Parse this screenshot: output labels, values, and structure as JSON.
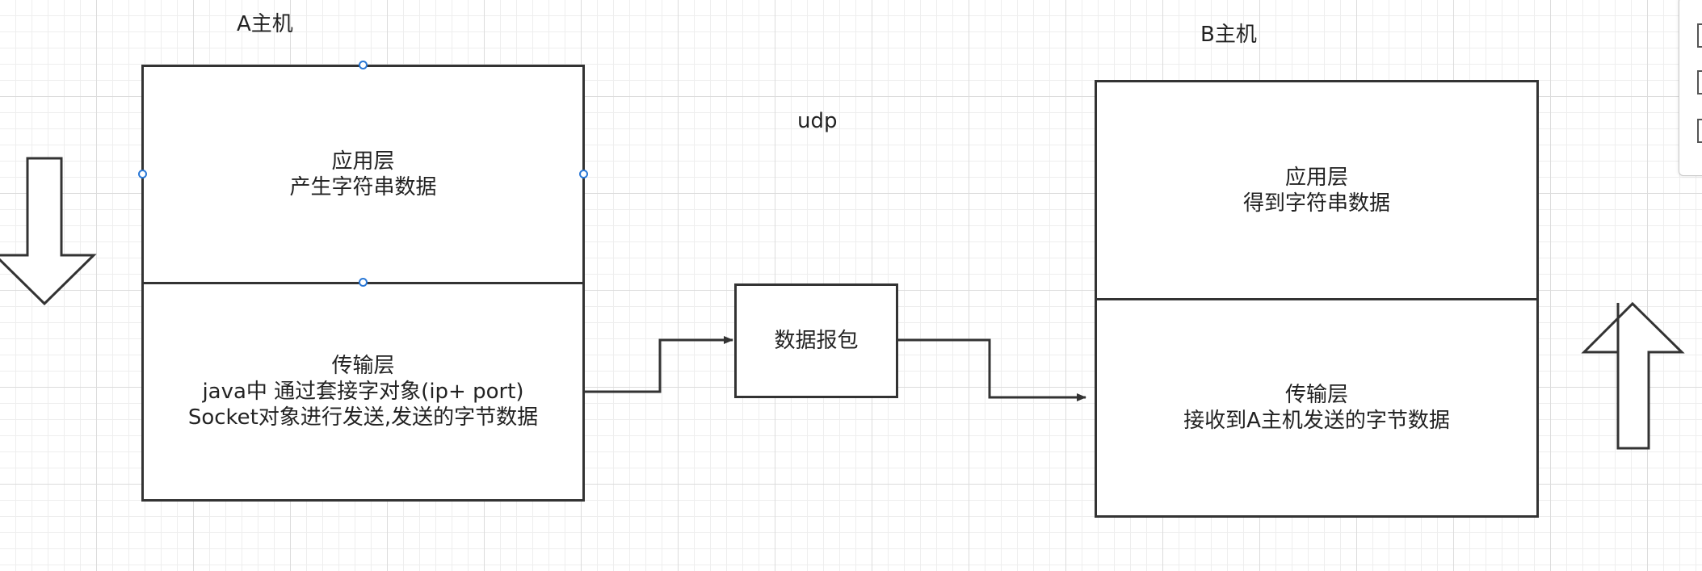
{
  "host_a": {
    "title": "A主机",
    "application_layer": {
      "line1": "应用层",
      "line2": "产生字符串数据"
    },
    "transport_layer": {
      "line1": "传输层",
      "line2": "java中 通过套接字对象(ip+ port)",
      "line3": "Socket对象进行发送,发送的字节数据"
    }
  },
  "protocol_label": "udp",
  "packet": {
    "label": "数据报包"
  },
  "host_b": {
    "title": "B主机",
    "application_layer": {
      "line1": "应用层",
      "line2": "得到字符串数据"
    },
    "transport_layer": {
      "line1": "传输层",
      "line2": "接收到A主机发送的字节数据"
    }
  },
  "colors": {
    "stroke": "#333333",
    "selection_handle": "#2a78d6",
    "grid_major": "#dcdcdc",
    "grid_minor": "#eeeeee"
  },
  "icons": {
    "left_arrow": "down-arrow-icon",
    "right_arrow": "up-arrow-icon"
  }
}
